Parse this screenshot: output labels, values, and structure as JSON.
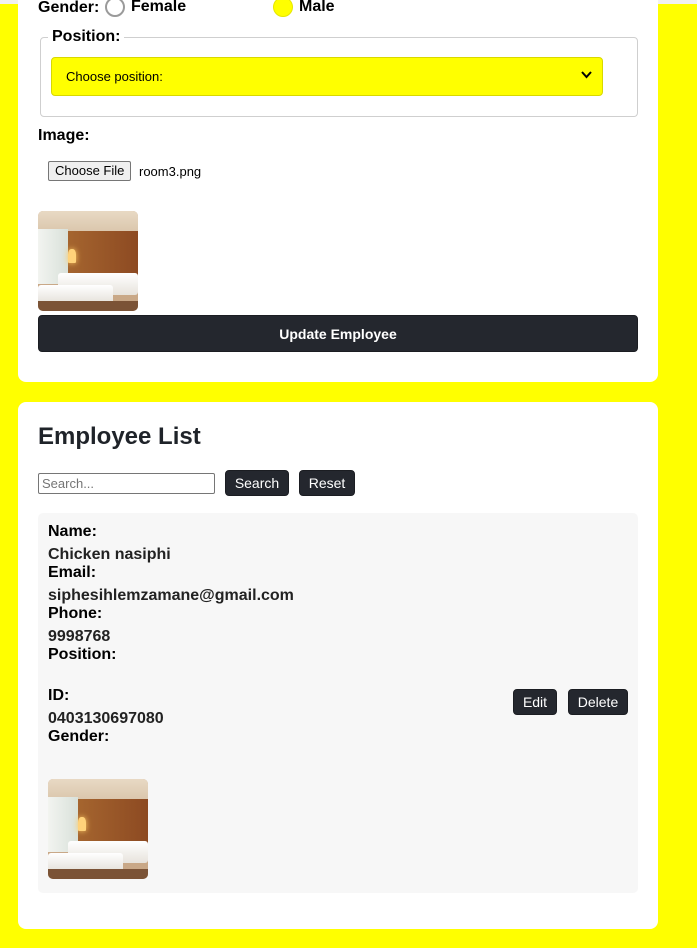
{
  "form": {
    "gender_label": "Gender:",
    "gender_options": [
      {
        "label": "Female",
        "selected": false
      },
      {
        "label": "Male",
        "selected": true
      }
    ],
    "position_legend": "Position:",
    "position_select_value": "Choose position:",
    "image_label": "Image:",
    "choose_file_label": "Choose File",
    "file_name": "room3.png",
    "preview_image": "room-photo",
    "update_button": "Update Employee"
  },
  "list": {
    "title": "Employee List",
    "search_placeholder": "Search...",
    "search_button": "Search",
    "reset_button": "Reset",
    "employees": [
      {
        "name_label": "Name:",
        "name": "Chicken nasiphi",
        "email_label": "Email:",
        "email": "siphesihlemzamane@gmail.com",
        "phone_label": "Phone:",
        "phone": "9998768",
        "position_label": "Position:",
        "position": "",
        "id_label": "ID:",
        "id": "0403130697080",
        "gender_label": "Gender:",
        "gender": "",
        "photo": "room-photo",
        "edit_button": "Edit",
        "delete_button": "Delete"
      }
    ]
  },
  "colors": {
    "page_background": "#ffff00",
    "card_background": "#ffffff",
    "button_dark": "#24272e",
    "employee_card_background": "#f7f7f7"
  }
}
